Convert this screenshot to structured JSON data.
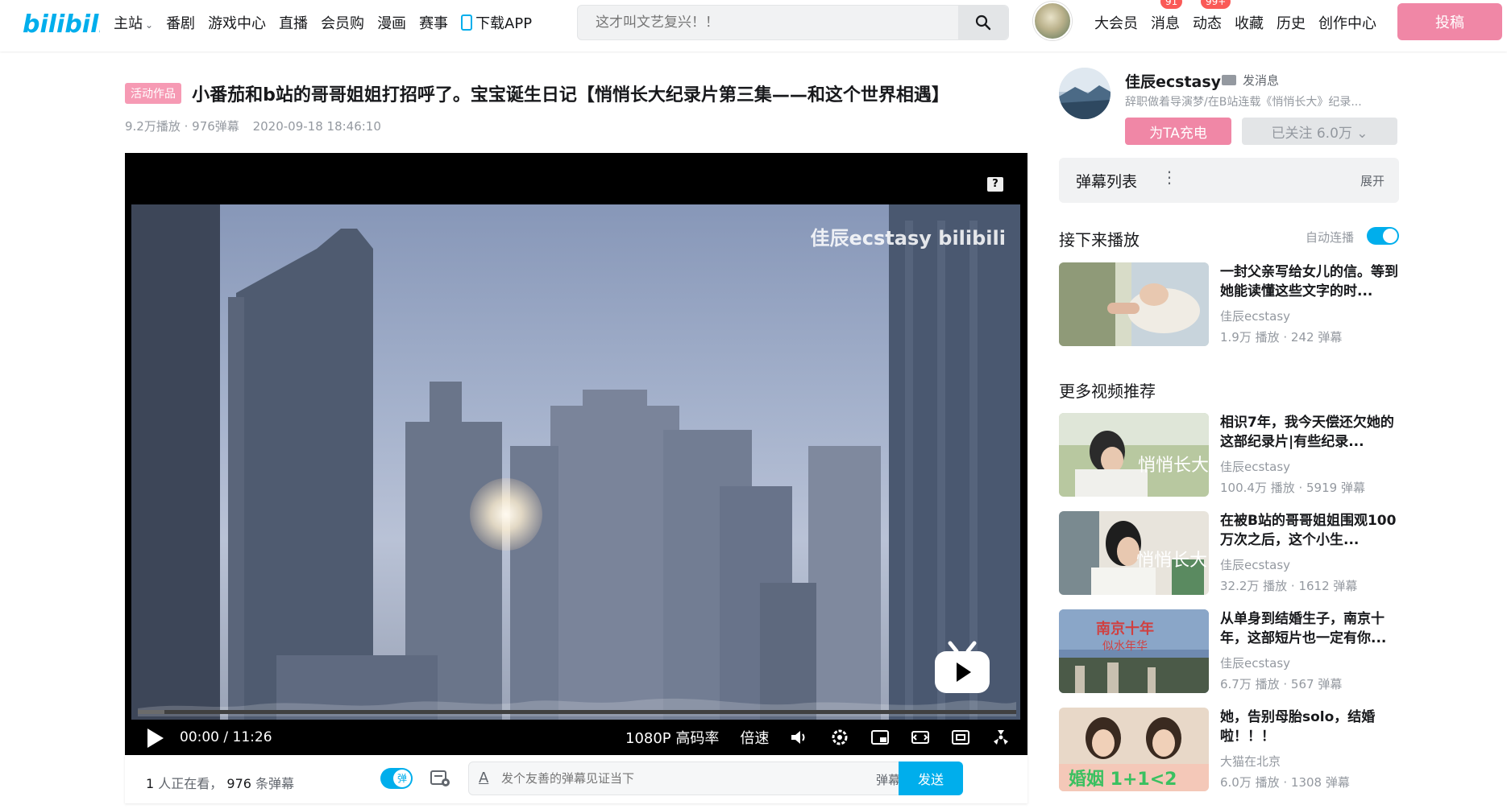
{
  "header": {
    "logo_text": "bilibili",
    "nav": [
      "主站",
      "番剧",
      "游戏中心",
      "直播",
      "会员购",
      "漫画",
      "赛事"
    ],
    "download": "下载APP",
    "search_placeholder": "这才叫文艺复兴！！",
    "right_nav": [
      {
        "label": "大会员",
        "badge": ""
      },
      {
        "label": "消息",
        "badge": "91"
      },
      {
        "label": "动态",
        "badge": "99+"
      },
      {
        "label": "收藏",
        "badge": ""
      },
      {
        "label": "历史",
        "badge": ""
      },
      {
        "label": "创作中心",
        "badge": ""
      }
    ],
    "upload": "投稿"
  },
  "video": {
    "tag": "活动作品",
    "title": "小番茄和b站的哥哥姐姐打招呼了。宝宝诞生日记【悄悄长大纪录片第三集——和这个世界相遇】",
    "plays": "9.2万播放 · 976弹幕",
    "date": "2020-09-18 18:46:10",
    "watermark": "佳辰ecstasy bilibili",
    "help": "?"
  },
  "player": {
    "current": "00:00",
    "sep": "/",
    "duration": "11:26",
    "quality": "1080P 高码率",
    "speed": "倍速",
    "progress": 0.03
  },
  "danmaku_bar": {
    "watching_count": "1",
    "watching_label": "人正在看，",
    "danmaku_count": "976",
    "danmaku_label": "条弹幕",
    "toggle_label": "弹",
    "input_placeholder": "发个友善的弹幕见证当下",
    "gift": "弹幕礼仪 ›",
    "send": "发送"
  },
  "up": {
    "name": "佳辰ecstasy",
    "message": "发消息",
    "desc": "辞职做着导演梦/在B站连载《悄悄长大》纪录...",
    "charge": "为TA充电",
    "follow": "已关注 6.0万 ⌄"
  },
  "danmaku_list": {
    "title": "弹幕列表",
    "dots": "⋮",
    "expand": "展开"
  },
  "next": {
    "heading": "接下来播放",
    "autoplay": "自动连播",
    "card": {
      "title": "一封父亲写给女儿的信。等到她能读懂这些文字的时...",
      "up": "佳辰ecstasy",
      "stats": "1.9万 播放 · 242 弹幕"
    }
  },
  "more": {
    "heading": "更多视频推荐",
    "cards": [
      {
        "title": "相识7年，我今天偿还欠她的这部纪录片|有些纪录...",
        "up": "佳辰ecstasy",
        "stats": "100.4万 播放 · 5919 弹幕"
      },
      {
        "title": "在被B站的哥哥姐姐围观100万次之后，这个小生...",
        "up": "佳辰ecstasy",
        "stats": "32.2万 播放 · 1612 弹幕"
      },
      {
        "title": "从单身到结婚生子，南京十年，这部短片也一定有你...",
        "up": "佳辰ecstasy",
        "stats": "6.7万 播放 · 567 弹幕"
      },
      {
        "title": "她，告别母胎solo，结婚啦！！！",
        "up": "大猫在北京",
        "stats": "6.0万 播放 · 1308 弹幕"
      }
    ]
  },
  "colors": {
    "brand_blue": "#00aeec",
    "pink": "#f087a6"
  }
}
